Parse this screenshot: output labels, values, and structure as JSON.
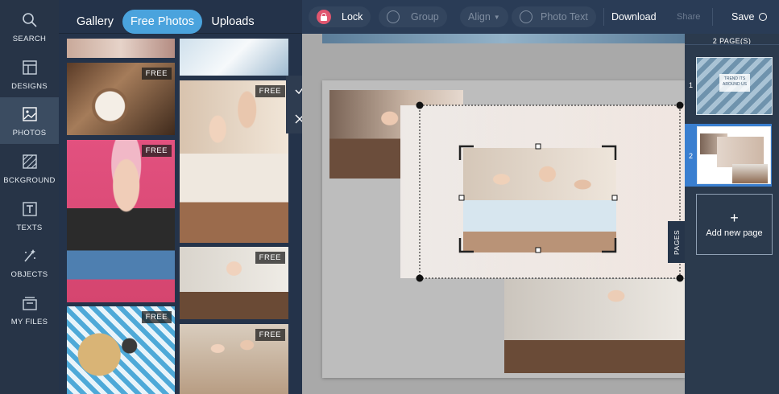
{
  "rail": {
    "items": [
      {
        "label": "SEARCH",
        "icon": "search-icon"
      },
      {
        "label": "DESIGNS",
        "icon": "designs-icon"
      },
      {
        "label": "PHOTOS",
        "icon": "photos-icon"
      },
      {
        "label": "BCKGROUND",
        "icon": "background-icon"
      },
      {
        "label": "TEXTS",
        "icon": "texts-icon"
      },
      {
        "label": "OBJECTS",
        "icon": "objects-icon"
      },
      {
        "label": "MY FILES",
        "icon": "my-files-icon"
      }
    ],
    "active_index": 2
  },
  "panel": {
    "tabs": [
      "Gallery",
      "Free Photos",
      "Uploads"
    ],
    "active_tab": "Free Photos",
    "badge": "FREE"
  },
  "toolbar": {
    "lock": "Lock",
    "group": "Group",
    "align": "Align",
    "photo_text": "Photo Text",
    "download": "Download",
    "share": "Share",
    "save": "Save"
  },
  "pages": {
    "header": "2 PAGE(S)",
    "page_numbers": [
      "1",
      "2"
    ],
    "thumb1_text": "TREND ITS AROUND US",
    "add_label": "Add new page",
    "tab_label": "PAGES"
  },
  "colors": {
    "accent": "#4aa3dd",
    "panel_bg": "#24334a",
    "rail_bg": "#273447",
    "canvas_bg": "#a9a9a9"
  }
}
